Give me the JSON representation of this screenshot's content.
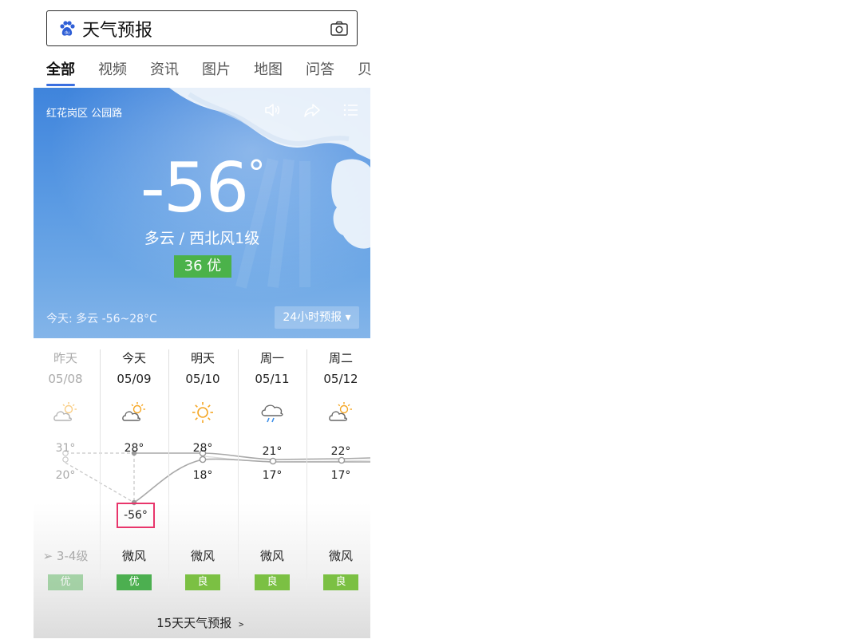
{
  "search": {
    "query": "天气预报"
  },
  "tabs": [
    {
      "label": "全部",
      "active": true
    },
    {
      "label": "视频"
    },
    {
      "label": "资讯"
    },
    {
      "label": "图片"
    },
    {
      "label": "地图"
    },
    {
      "label": "问答"
    },
    {
      "label": "贝"
    }
  ],
  "current": {
    "location": "红花岗区 公园路",
    "temperature": "-56",
    "degree": "°",
    "condition": "多云 / 西北风1级",
    "aqi": "36 优",
    "today_summary": "今天:  多云  -56~28°C",
    "hourly_button": "24小时预报 ▾"
  },
  "forecast": [
    {
      "day": "昨天",
      "date": "05/08",
      "icon": "partly-cloudy-icon",
      "high": "31°",
      "low": "20°",
      "wind": "➢ 3-4级",
      "aqi": "优",
      "aqi_color": "#4caf50",
      "past": true
    },
    {
      "day": "今天",
      "date": "05/09",
      "icon": "partly-cloudy-icon",
      "high": "28°",
      "low": "-56°",
      "wind": "微风",
      "aqi": "优",
      "aqi_color": "#4caf50",
      "past": false
    },
    {
      "day": "明天",
      "date": "05/10",
      "icon": "sunny-icon",
      "high": "28°",
      "low": "18°",
      "wind": "微风",
      "aqi": "良",
      "aqi_color": "#7bc043",
      "past": false
    },
    {
      "day": "周一",
      "date": "05/11",
      "icon": "rain-icon",
      "high": "21°",
      "low": "17°",
      "wind": "微风",
      "aqi": "良",
      "aqi_color": "#7bc043",
      "past": false
    },
    {
      "day": "周二",
      "date": "05/12",
      "icon": "partly-cloudy-icon",
      "high": "22°",
      "low": "17°",
      "wind": "微风",
      "aqi": "良",
      "aqi_color": "#7bc043",
      "past": false
    }
  ],
  "footer": "15天天气预报 ﹥",
  "colors": {
    "accent": "#3a6fe0",
    "aqi_good": "#4bb24a",
    "highlight": "#e8356b"
  }
}
